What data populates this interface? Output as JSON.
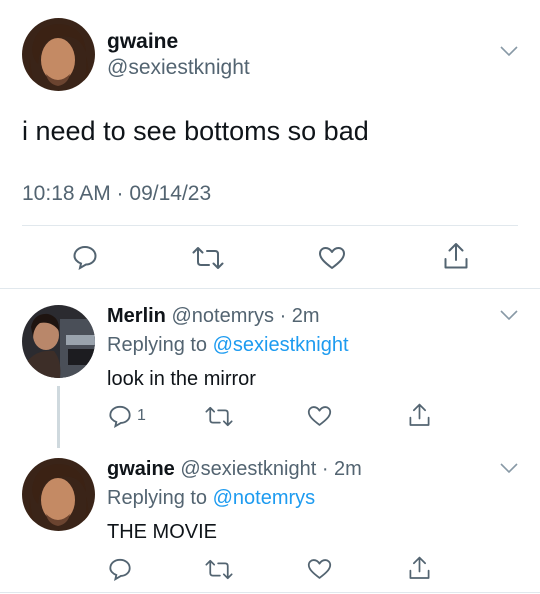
{
  "tweet": {
    "name": "gwaine",
    "handle": "@sexiestknight",
    "text": "i need to see bottoms so bad",
    "timestamp": "10:18 AM · 09/14/23",
    "actions": [
      "reply-icon",
      "retweet-icon",
      "like-icon",
      "share-icon"
    ]
  },
  "replies": [
    {
      "name": "Merlin",
      "handle_time": "@notemrys · 2m",
      "replying_label": "Replying to ",
      "replying_to": "@sexiestknight",
      "text": "look in the mirror",
      "reply_count": "1"
    },
    {
      "name": "gwaine",
      "handle_time": "@sexiestknight · 2m",
      "replying_label": "Replying to ",
      "replying_to": "@notemrys",
      "text": "THE MOVIE",
      "reply_count": ""
    }
  ],
  "colors": {
    "text": "#0f1419",
    "secondary": "#536471",
    "link": "#1d9bf0",
    "divider": "#e1e8ed"
  }
}
